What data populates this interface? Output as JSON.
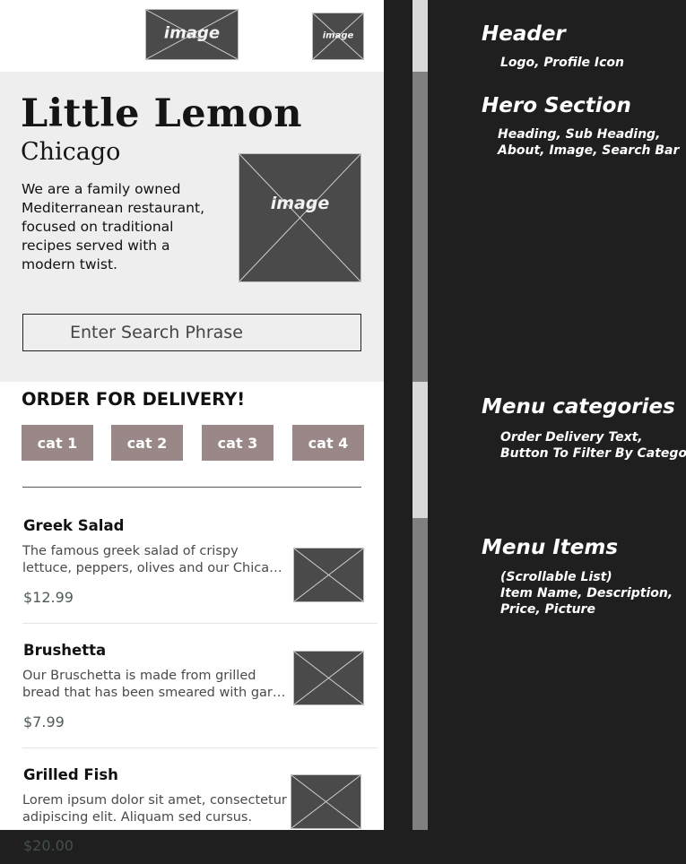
{
  "header": {
    "logo_placeholder": "image",
    "profile_placeholder": "image"
  },
  "hero": {
    "title": "Little Lemon",
    "subtitle": "Chicago",
    "about_lines": [
      "We are a family owned",
      "Mediterranean restaurant,",
      "focused on traditional",
      "recipes served with a",
      "modern twist."
    ],
    "image_placeholder": "image",
    "search_placeholder": "Enter Search Phrase"
  },
  "menu_categories": {
    "order_text": "ORDER FOR DELIVERY!",
    "categories": [
      "cat 1",
      "cat 2",
      "cat 3",
      "cat 4"
    ]
  },
  "menu_items": [
    {
      "name": "Greek Salad",
      "description_lines": [
        "The famous greek salad of crispy",
        "lettuce, peppers, olives and our Chicago style feta cheese"
      ],
      "price": "$12.99"
    },
    {
      "name": "Brushetta",
      "description_lines": [
        "Our Bruschetta is made from grilled",
        "bread that has been smeared with garlic and seasoned"
      ],
      "price": "$7.99"
    },
    {
      "name": "Grilled Fish",
      "description_lines": [
        "Lorem ipsum dolor sit amet, consectetur",
        "adipiscing elit. Aliquam sed cursus."
      ],
      "price": "$20.00"
    }
  ],
  "annotations": {
    "header": {
      "title": "Header",
      "lines": [
        "Logo, Profile Icon"
      ]
    },
    "hero": {
      "title": "Hero Section",
      "lines": [
        "Heading, Sub Heading,",
        "About, Image, Search Bar"
      ]
    },
    "categories": {
      "title": "Menu categories",
      "lines": [
        "Order Delivery Text,",
        "Button To Filter By Category"
      ]
    },
    "items": {
      "title": "Menu Items",
      "lines": [
        "(Scrollable List)",
        "Item Name, Description,",
        "Price, Picture"
      ]
    }
  },
  "colors": {
    "background": "#1f1f1f",
    "hero_bg": "#eeeeee",
    "category_button": "#9a8888",
    "placeholder": "#4a4a4a",
    "strip_light": "#d9d9d9",
    "strip_dark": "#808080"
  }
}
